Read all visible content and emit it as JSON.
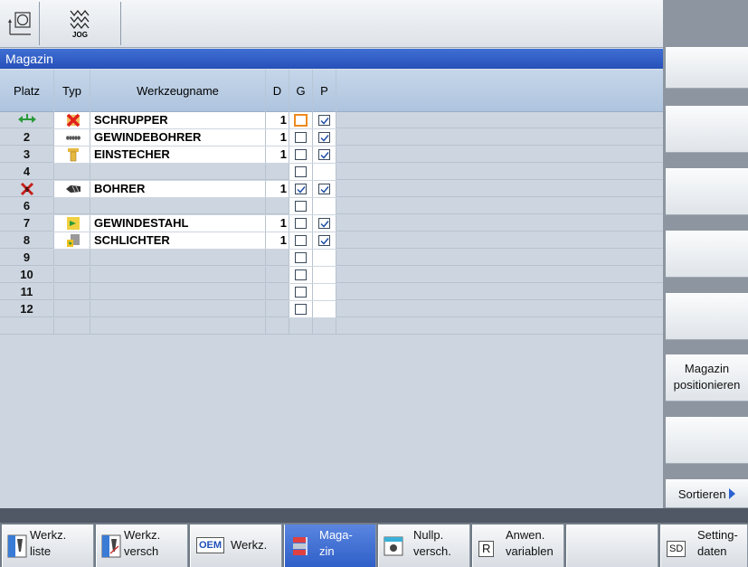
{
  "mode": {
    "jog_label": "JOG"
  },
  "title": "Magazin",
  "table": {
    "headers": {
      "platz": "Platz",
      "typ": "Typ",
      "name": "Werkzeugname",
      "d": "D",
      "g": "G",
      "p": "P"
    },
    "rows": [
      {
        "platz": "",
        "platz_icon": "load-position-icon",
        "tool_icon": "roughing-tool-icon",
        "name": "SCHRUPPER",
        "d": "1",
        "g": false,
        "p": true,
        "selected": true
      },
      {
        "platz": "2",
        "tool_icon": "tap-icon",
        "name": "GEWINDEBOHRER",
        "d": "1",
        "g": false,
        "p": true
      },
      {
        "platz": "3",
        "tool_icon": "grooving-tool-icon",
        "name": "EINSTECHER",
        "d": "1",
        "g": false,
        "p": true
      },
      {
        "platz": "4",
        "name": "",
        "d": "",
        "g": false,
        "p": null
      },
      {
        "platz": "",
        "platz_icon": "disabled-location-icon",
        "tool_icon": "drill-icon",
        "name": "BOHRER",
        "d": "1",
        "g": true,
        "p": true
      },
      {
        "platz": "6",
        "name": "",
        "d": "",
        "g": false,
        "p": null
      },
      {
        "platz": "7",
        "tool_icon": "threading-tool-icon",
        "name": "GEWINDESTAHL",
        "d": "1",
        "g": false,
        "p": true
      },
      {
        "platz": "8",
        "tool_icon": "finishing-tool-icon",
        "name": "SCHLICHTER",
        "d": "1",
        "g": false,
        "p": true
      },
      {
        "platz": "9",
        "name": "",
        "d": "",
        "g": false,
        "p": null
      },
      {
        "platz": "10",
        "name": "",
        "d": "",
        "g": false,
        "p": null
      },
      {
        "platz": "11",
        "name": "",
        "d": "",
        "g": false,
        "p": null
      },
      {
        "platz": "12",
        "name": "",
        "d": "",
        "g": false,
        "p": null
      }
    ]
  },
  "vertical_softkeys": {
    "magazin_pos_line1": "Magazin",
    "magazin_pos_line2": "positionieren",
    "sortieren": "Sortieren"
  },
  "horizontal_softkeys": {
    "werkz_liste_1": "Werkz.",
    "werkz_liste_2": "liste",
    "werkz_versch_1": "Werkz.",
    "werkz_versch_2": "versch",
    "oem_badge": "OEM",
    "oem_werkz": "Werkz.",
    "magazin_1": "Maga-",
    "magazin_2": "zin",
    "nullp_1": "Nullp.",
    "nullp_2": "versch.",
    "anwen_badge": "R",
    "anwen_1": "Anwen.",
    "anwen_2": "variablen",
    "sd_badge": "SD",
    "setting_1": "Setting-",
    "setting_2": "daten"
  },
  "colors": {
    "title_bar": "#2f5cc6",
    "selection": "#ee8a1c",
    "active_softkey": "#3a68d0"
  }
}
